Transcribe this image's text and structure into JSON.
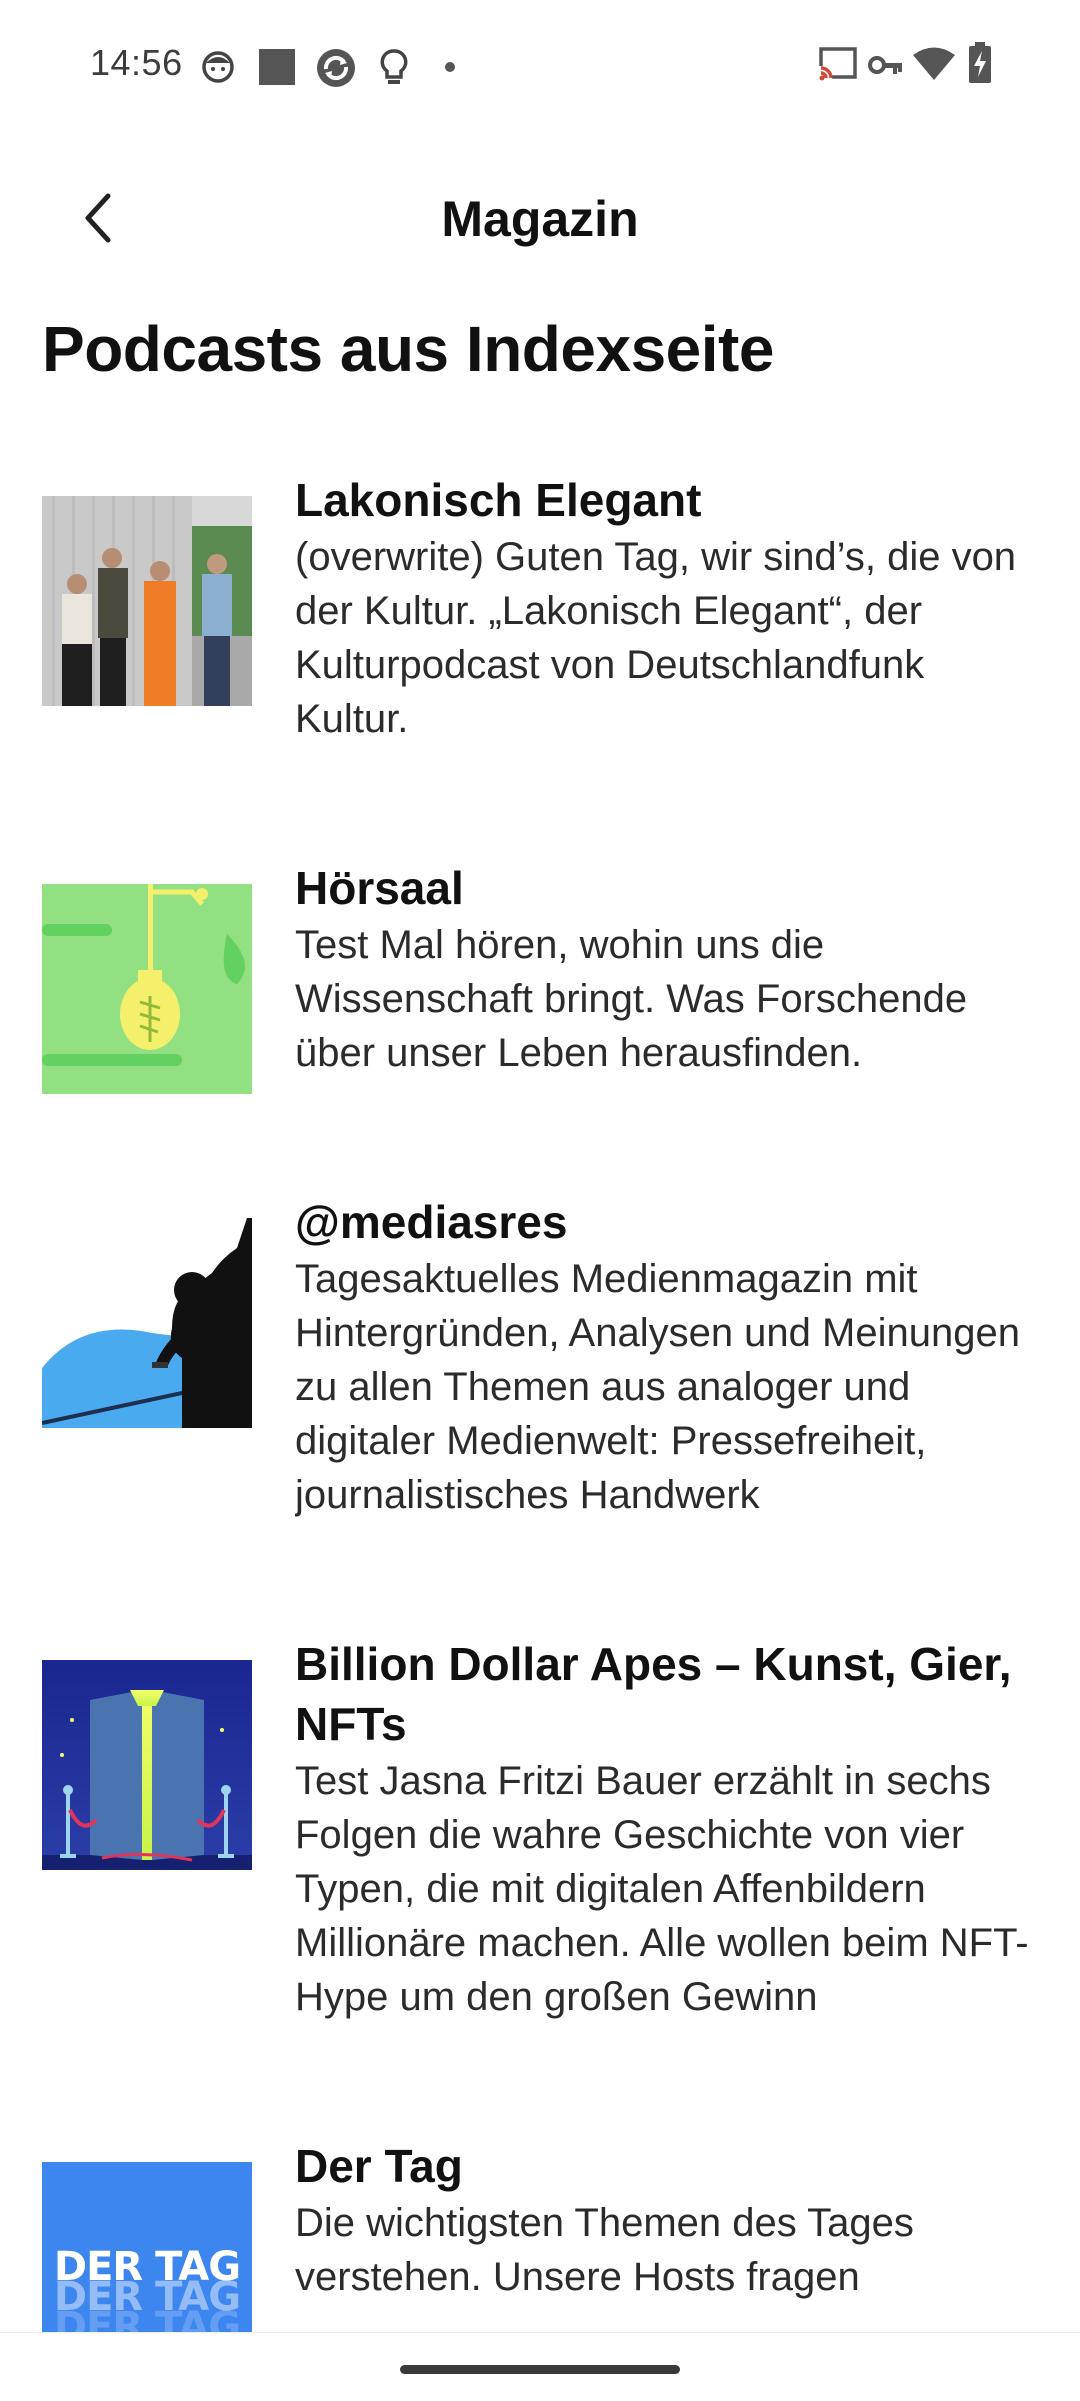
{
  "status_bar": {
    "time": "14:56",
    "left_icons": [
      "face-icon",
      "square-icon",
      "sync-icon",
      "lightbulb-icon",
      "dot-icon"
    ],
    "right_icons": [
      "cast-icon",
      "vpn-key-icon",
      "wifi-icon",
      "battery-charging-icon"
    ]
  },
  "header": {
    "title": "Magazin",
    "back_icon": "chevron-left-icon"
  },
  "section": {
    "title": "Podcasts aus Indexseite"
  },
  "podcasts": [
    {
      "title": "Lakonisch Elegant",
      "description": "(overwrite) Guten Tag, wir sind’s, die von der Kultur. „Lakonisch Elegant“, der Kulturpodcast von Deutschlandfunk Kultur."
    },
    {
      "title": "Hörsaal",
      "description": "Test Mal hören, wohin uns die Wissenschaft bringt. Was Forschende über unser Leben herausfinden."
    },
    {
      "title": "@mediasres",
      "description": "Tagesaktuelles Medienmagazin mit Hintergründen, Analysen und Meinungen zu allen Themen aus analoger und digitaler Medienwelt: Pressefreiheit, journalistisches Handwerk"
    },
    {
      "title": "Billion Dollar Apes – Kunst, Gier, NFTs",
      "description": "Test Jasna Fritzi Bauer erzählt in sechs Folgen die wahre Geschichte von vier Typen, die mit digitalen Affenbildern Millionäre machen. Alle wollen beim NFT-Hype um den großen Gewinn"
    },
    {
      "title": "Der Tag",
      "description": "Die wichtigsten Themen des Tages verstehen. Unsere Hosts fragen",
      "cover_text": "DER TAG"
    }
  ],
  "colors": {
    "accent_green": "#93e082",
    "accent_yellow": "#f4f06b",
    "sky_blue": "#4aaaf0",
    "navy": "#1f2e86",
    "der_tag_blue": "#3d86ef"
  }
}
